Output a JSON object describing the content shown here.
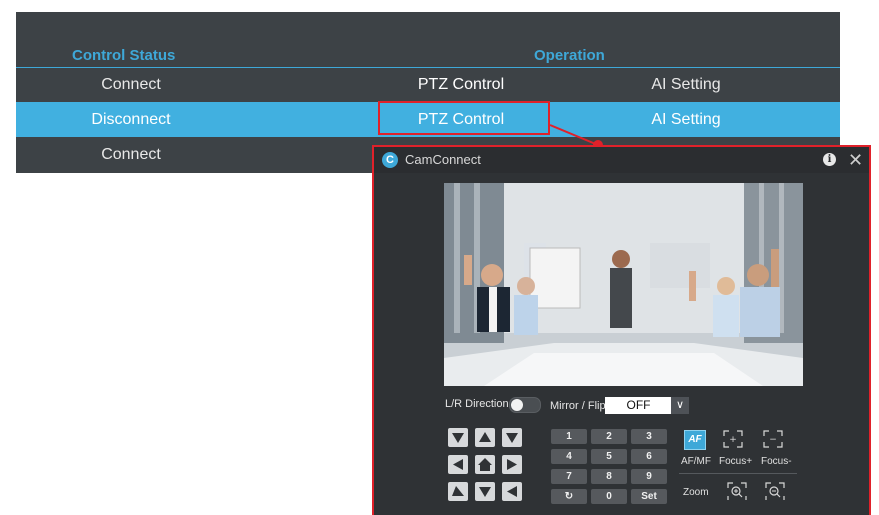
{
  "table": {
    "headers": {
      "control_status": "Control Status",
      "operation": "Operation"
    },
    "rows": [
      {
        "status": "Connect",
        "ptz": "PTZ Control",
        "ai": "AI Setting"
      },
      {
        "status": "Disconnect",
        "ptz": "PTZ Control",
        "ai": "AI Setting"
      },
      {
        "status": "Connect"
      }
    ]
  },
  "window": {
    "title": "CamConnect",
    "controls": {
      "lr_direction_label": "L/R Direction",
      "mirror_flip_label": "Mirror / Flip",
      "mirror_flip_value": "OFF",
      "keypad": [
        "1",
        "2",
        "3",
        "4",
        "5",
        "6",
        "7",
        "8",
        "9",
        "↻",
        "0",
        "Set"
      ],
      "af_button": "AF",
      "af_mf_label": "AF/MF",
      "focus_plus_label": "Focus+",
      "focus_minus_label": "Focus-",
      "zoom_label": "Zoom"
    }
  },
  "colors": {
    "accent": "#3ea8d8",
    "highlight_border": "#e0212a",
    "panel": "#3d4246"
  }
}
